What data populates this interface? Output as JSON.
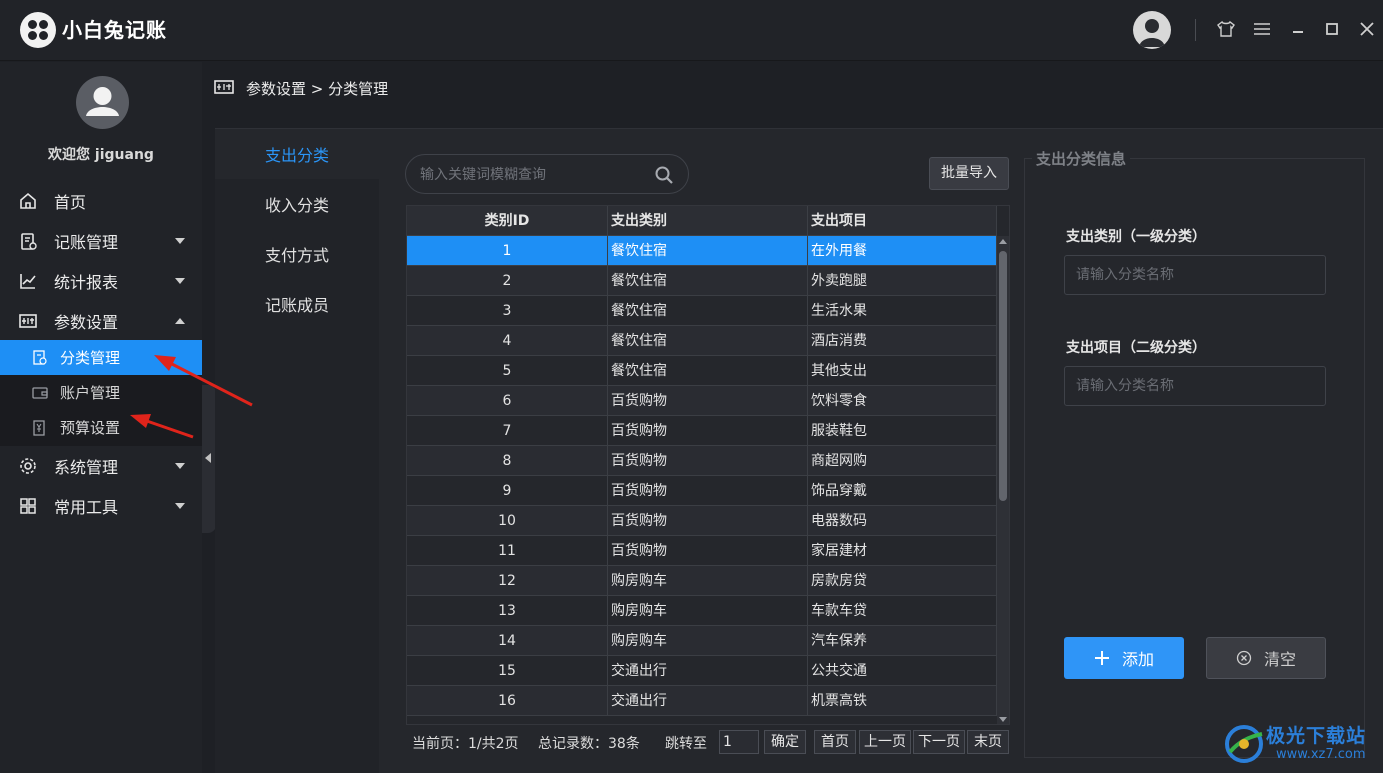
{
  "app": {
    "title": "小白兔记账"
  },
  "sidebar": {
    "welcome": "欢迎您 jiguang",
    "nav": [
      {
        "label": "首页",
        "icon": "home-icon"
      },
      {
        "label": "记账管理",
        "icon": "ledger-icon"
      },
      {
        "label": "统计报表",
        "icon": "chart-icon"
      },
      {
        "label": "参数设置",
        "icon": "settings-panel-icon"
      }
    ],
    "sub": [
      {
        "label": "分类管理",
        "icon": "category-icon",
        "active": true
      },
      {
        "label": "账户管理",
        "icon": "wallet-icon"
      },
      {
        "label": "预算设置",
        "icon": "budget-icon"
      }
    ],
    "nav2": [
      {
        "label": "系统管理",
        "icon": "gear-icon"
      },
      {
        "label": "常用工具",
        "icon": "grid-icon"
      }
    ]
  },
  "breadcrumb": "参数设置 > 分类管理",
  "tabs": [
    "支出分类",
    "收入分类",
    "支付方式",
    "记账成员"
  ],
  "search": {
    "placeholder": "输入关键词模糊查询"
  },
  "import_label": "批量导入",
  "table": {
    "headers": [
      "类别ID",
      "支出类别",
      "支出项目"
    ],
    "rows": [
      [
        "1",
        "餐饮住宿",
        "在外用餐"
      ],
      [
        "2",
        "餐饮住宿",
        "外卖跑腿"
      ],
      [
        "3",
        "餐饮住宿",
        "生活水果"
      ],
      [
        "4",
        "餐饮住宿",
        "酒店消费"
      ],
      [
        "5",
        "餐饮住宿",
        "其他支出"
      ],
      [
        "6",
        "百货购物",
        "饮料零食"
      ],
      [
        "7",
        "百货购物",
        "服装鞋包"
      ],
      [
        "8",
        "百货购物",
        "商超网购"
      ],
      [
        "9",
        "百货购物",
        "饰品穿戴"
      ],
      [
        "10",
        "百货购物",
        "电器数码"
      ],
      [
        "11",
        "百货购物",
        "家居建材"
      ],
      [
        "12",
        "购房购车",
        "房款房贷"
      ],
      [
        "13",
        "购房购车",
        "车款车贷"
      ],
      [
        "14",
        "购房购车",
        "汽车保养"
      ],
      [
        "15",
        "交通出行",
        "公共交通"
      ],
      [
        "16",
        "交通出行",
        "机票高铁"
      ]
    ]
  },
  "pager": {
    "current": "当前页：1/共2页",
    "total": "总记录数：38条",
    "jump_label": "跳转至",
    "jump_value": "1",
    "confirm": "确定",
    "first": "首页",
    "prev": "上一页",
    "next": "下一页",
    "last": "末页"
  },
  "info": {
    "legend": "支出分类信息",
    "cat_label": "支出类别（一级分类）",
    "cat_placeholder": "请输入分类名称",
    "item_label": "支出项目（二级分类）",
    "item_placeholder": "请输入分类名称",
    "add": "添加",
    "clear": "清空"
  },
  "watermark": {
    "text": "极光下载站",
    "url": "www.xz7.com"
  },
  "colors": {
    "accent": "#1e8ff5",
    "annotation": "#e0241b"
  }
}
